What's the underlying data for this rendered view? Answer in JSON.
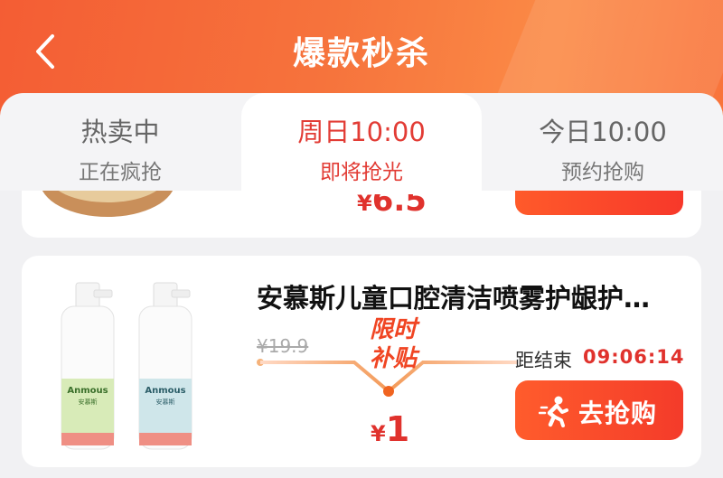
{
  "header": {
    "title": "爆款秒杀",
    "back_icon": "chevron-left-icon",
    "accent_color": "#f45d34"
  },
  "tabs": [
    {
      "title": "热卖中",
      "subtitle": "正在疯抢",
      "active": false
    },
    {
      "title": "周日10:00",
      "subtitle": "即将抢光",
      "active": true
    },
    {
      "title": "今日10:00",
      "subtitle": "预约抢购",
      "active": false
    }
  ],
  "prev_item": {
    "price_symbol": "¥",
    "price": "6.5"
  },
  "product": {
    "name": "安慕斯儿童口腔清洁喷雾护龈护…",
    "original_price": "¥19.9",
    "price_symbol": "¥",
    "price": "1",
    "badge_line1": "限时",
    "badge_line2": "补贴",
    "countdown_label": "距结束",
    "countdown_time": "09:06:14",
    "buy_label": "去抢购",
    "bottle_brand": "Anmous",
    "bottle_sub": "安慕斯"
  }
}
